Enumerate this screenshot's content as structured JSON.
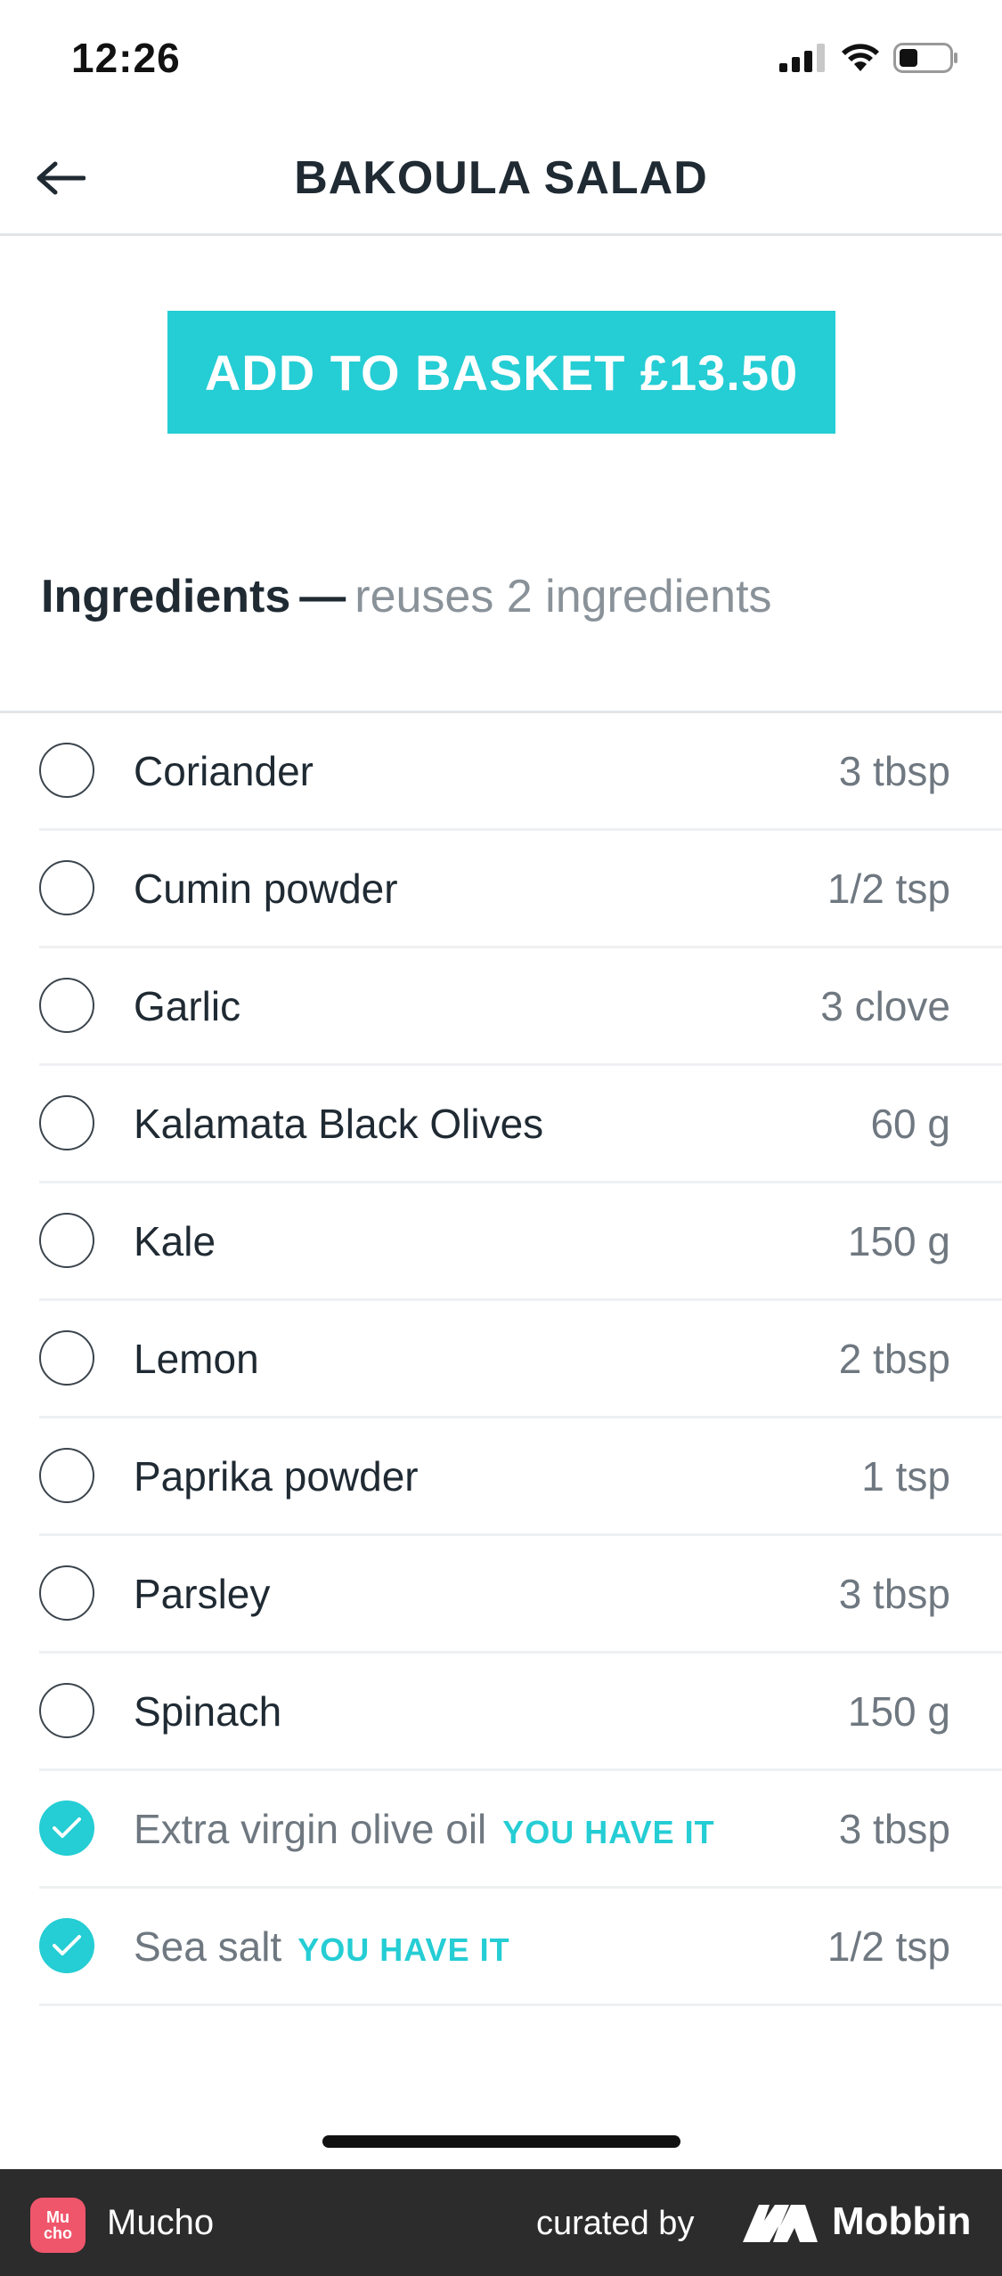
{
  "status_bar": {
    "time": "12:26"
  },
  "header": {
    "title": "BAKOULA SALAD",
    "back_icon": "arrow-left-icon"
  },
  "cta": {
    "label": "ADD TO BASKET £13.50"
  },
  "section": {
    "heading": "Ingredients",
    "separator": "—",
    "subheading": "reuses 2 ingredients"
  },
  "ingredients": [
    {
      "name": "Coriander",
      "qty": "3 tbsp",
      "owned": false
    },
    {
      "name": "Cumin powder",
      "qty": "1/2 tsp",
      "owned": false
    },
    {
      "name": "Garlic",
      "qty": "3 clove",
      "owned": false
    },
    {
      "name": "Kalamata Black Olives",
      "qty": "60 g",
      "owned": false
    },
    {
      "name": "Kale",
      "qty": "150 g",
      "owned": false
    },
    {
      "name": "Lemon",
      "qty": "2 tbsp",
      "owned": false
    },
    {
      "name": "Paprika powder",
      "qty": "1 tsp",
      "owned": false
    },
    {
      "name": "Parsley",
      "qty": "3 tbsp",
      "owned": false
    },
    {
      "name": "Spinach",
      "qty": "150 g",
      "owned": false
    },
    {
      "name": "Extra virgin olive oil",
      "qty": "3 tbsp",
      "owned": true,
      "badge": "YOU HAVE IT"
    },
    {
      "name": "Sea salt",
      "qty": "1/2 tsp",
      "owned": true,
      "badge": "YOU HAVE IT"
    }
  ],
  "footer": {
    "app_name": "Mucho",
    "logo_text": "Mu cho",
    "curated_by": "curated by",
    "brand": "Mobbin"
  },
  "colors": {
    "accent": "#25cdd4",
    "text": "#1f2a33",
    "muted": "#8a9299",
    "footer_bg": "#2c2c2c",
    "logo_bg": "#f0566b"
  }
}
